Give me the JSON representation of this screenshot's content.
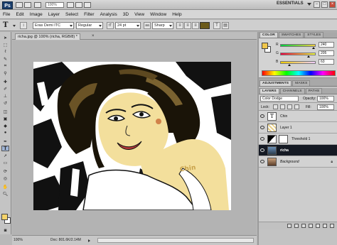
{
  "appbar": {
    "logo": "Ps",
    "zoom": "100%",
    "workspace": "ESSENTIALS"
  },
  "menu": [
    "File",
    "Edit",
    "Image",
    "Layer",
    "Select",
    "Filter",
    "Analysis",
    "3D",
    "View",
    "Window",
    "Help"
  ],
  "options": {
    "font_family": "Eras Demi ITC",
    "font_style": "Regular",
    "font_size": "24 pt",
    "antialias": "Sharp",
    "text_color": "#6b5a1a"
  },
  "document": {
    "tab_label": "richa.jpg @ 100% (richa, RGB/8) *",
    "canvas_text": "Chin",
    "canvas_text_color": "#c9a24a"
  },
  "status": {
    "zoom": "100%",
    "doc": "Doc: 801.6K/2.14M"
  },
  "color_panel": {
    "tabs": [
      "COLOR",
      "SWATCHES",
      "STYLES"
    ],
    "r_label": "R",
    "g_label": "G",
    "b_label": "B",
    "r": "240",
    "g": "205",
    "b": "63",
    "r_level": 0.94,
    "g_level": 0.8,
    "b_level": 0.25,
    "fg_color": "#f0cd3f"
  },
  "adjust_tabs": [
    "ADJUSTMENTS",
    "MASKS"
  ],
  "layers_panel": {
    "tabs": [
      "LAYERS",
      "CHANNELS",
      "PATHS"
    ],
    "blend_mode": "Color Dodge",
    "opacity_label": "Opacity:",
    "opacity": "100%",
    "lock_label": "Lock:",
    "fill_label": "Fill:",
    "fill": "100%",
    "layers": [
      {
        "name": "Chin",
        "type": "text"
      },
      {
        "name": "Layer 1",
        "type": "raster"
      },
      {
        "name": "Threshold 1",
        "type": "adjustment"
      },
      {
        "name": "richa",
        "type": "raster",
        "selected": true
      },
      {
        "name": "Background",
        "type": "background"
      }
    ]
  }
}
